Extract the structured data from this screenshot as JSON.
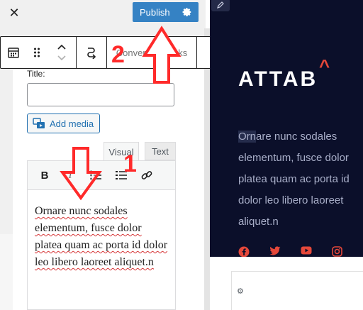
{
  "header": {
    "close_label": "✕",
    "publish_label": "Publish"
  },
  "block_toolbar": {
    "convert_label": "Convert to blocks"
  },
  "classic": {
    "title_label": "Title:",
    "title_value": "",
    "add_media_label": "Add media",
    "tab_visual": "Visual",
    "tab_text": "Text",
    "bold_label": "B",
    "italic_label": "I",
    "content": "Ornare nunc sodales elementum, fusce dolor platea quam ac porta id dolor leo libero laoreet aliquet.n"
  },
  "annotations": {
    "step1": "1",
    "step2": "2",
    "color": "#ff2a2a"
  },
  "preview": {
    "brand": "ATTAB",
    "brand_caret": "^",
    "text_first": "Orn",
    "text_rest": "are nunc sodales elementum, fusce dolor platea quam ac porta id dolor leo libero laoreet aliquet.n",
    "social_icons": [
      "facebook-icon",
      "twitter-icon",
      "youtube-icon",
      "instagram-icon"
    ],
    "accent_color": "#e5483a",
    "background_color": "#0b0f2a"
  }
}
